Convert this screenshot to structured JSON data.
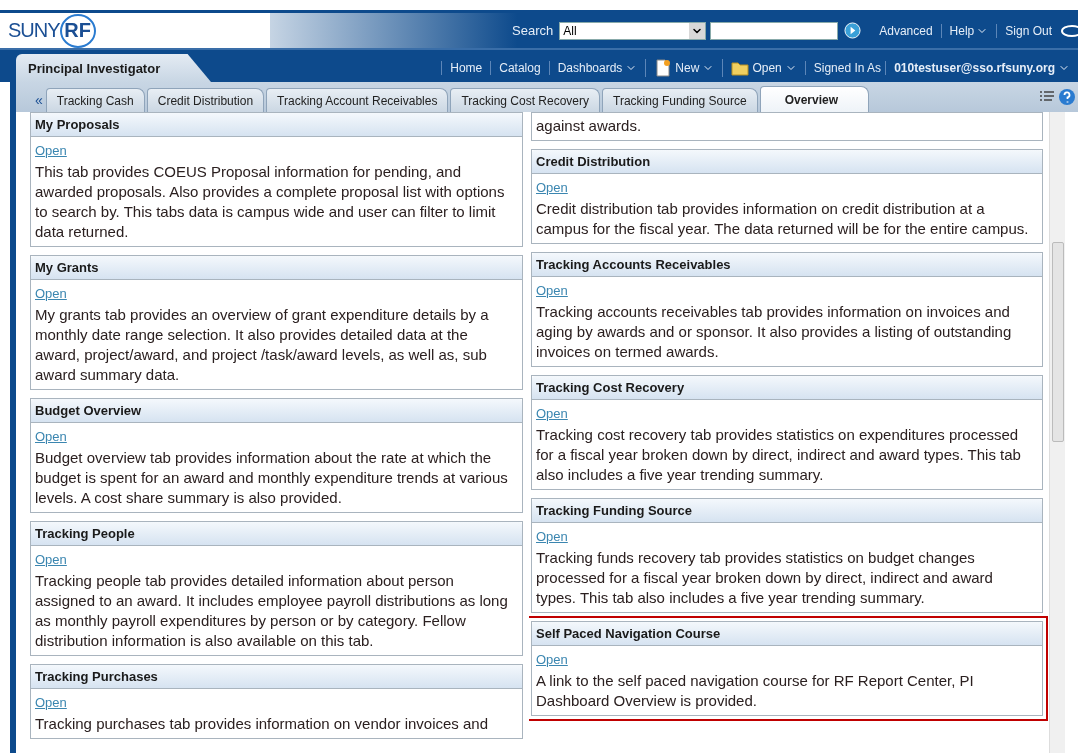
{
  "header": {
    "logo": {
      "left": "SUNY",
      "circle": "RF"
    },
    "search": {
      "label": "Search",
      "scope": "All"
    },
    "links": [
      {
        "label": "Advanced",
        "menu": false
      },
      {
        "label": "Help",
        "menu": true
      },
      {
        "label": "Sign Out",
        "menu": false
      }
    ]
  },
  "nav": {
    "title": "Principal Investigator",
    "items": [
      {
        "label": "Home",
        "kind": "link",
        "menu": false
      },
      {
        "label": "Catalog",
        "kind": "link",
        "menu": false
      },
      {
        "label": "Dashboards",
        "kind": "link",
        "menu": true
      },
      {
        "label": "New",
        "kind": "new",
        "menu": true
      },
      {
        "label": "Open",
        "kind": "open",
        "menu": true
      },
      {
        "label": "Signed In As",
        "kind": "text"
      },
      {
        "label": "010testuser@sso.rfsuny.org",
        "kind": "user",
        "menu": true
      }
    ]
  },
  "tabs": [
    {
      "label": "Tracking Cash",
      "selected": false
    },
    {
      "label": "Credit Distribution",
      "selected": false
    },
    {
      "label": "Tracking Account Receivables",
      "selected": false
    },
    {
      "label": "Tracking Cost Recovery",
      "selected": false
    },
    {
      "label": "Tracking Funding Source",
      "selected": false
    },
    {
      "label": "Overview",
      "selected": true
    }
  ],
  "tab_scroll": "«",
  "columns": [
    [
      {
        "title": "My Proposals",
        "link": "Open",
        "description": "This tab provides COEUS Proposal information for pending, and awarded proposals. Also provides a complete proposal list with options to search by. This tabs data is campus wide and user can filter to limit data returned.",
        "highlighted": false
      },
      {
        "title": "My Grants",
        "link": "Open",
        "description": "My grants tab provides an overview of grant expenditure details by a monthly date range selection. It also provides detailed data at the award, project/award, and project /task/award levels, as well as, sub award summary data.",
        "highlighted": false
      },
      {
        "title": "Budget Overview",
        "link": "Open",
        "description": "Budget overview tab provides information about the rate at which the budget is spent for an award and monthly expenditure trends at various levels. A cost share summary is also provided.",
        "highlighted": false
      },
      {
        "title": "Tracking People",
        "link": "Open",
        "description": "Tracking people tab provides detailed information about person assigned to an award. It includes employee payroll distributions as long as monthly payroll expenditures by person or by category. Fellow distribution information is also available on this tab.",
        "highlighted": false
      },
      {
        "title": "Tracking Purchases",
        "link": "Open",
        "description": "Tracking purchases tab provides information on vendor invoices and",
        "highlighted": false
      }
    ],
    [
      {
        "description": "against awards.",
        "highlighted": false
      },
      {
        "title": "Credit Distribution",
        "link": "Open",
        "description": "Credit distribution tab provides information on credit distribution at a campus for the fiscal year. The data returned will be for the entire campus.",
        "highlighted": false
      },
      {
        "title": "Tracking Accounts Receivables",
        "link": "Open",
        "description": "Tracking accounts receivables tab provides information on invoices and aging by awards and or sponsor. It also provides a listing of outstanding invoices on termed awards.",
        "highlighted": false
      },
      {
        "title": "Tracking Cost Recovery",
        "link": "Open",
        "description": "Tracking cost recovery tab provides statistics on expenditures processed for a fiscal year broken down by direct, indirect and award types. This tab also includes a five year trending summary.",
        "highlighted": false
      },
      {
        "title": "Tracking Funding Source",
        "link": "Open",
        "description": "Tracking funds recovery tab provides statistics on budget changes processed for a fiscal year broken down by direct, indirect and award types. This tab also includes a five year trending summary.",
        "highlighted": false
      },
      {
        "title": "Self Paced Navigation Course",
        "link": "Open",
        "description": "A link to the self paced navigation course for RF Report Center, PI Dashboard Overview is provided.",
        "highlighted": true
      }
    ]
  ]
}
